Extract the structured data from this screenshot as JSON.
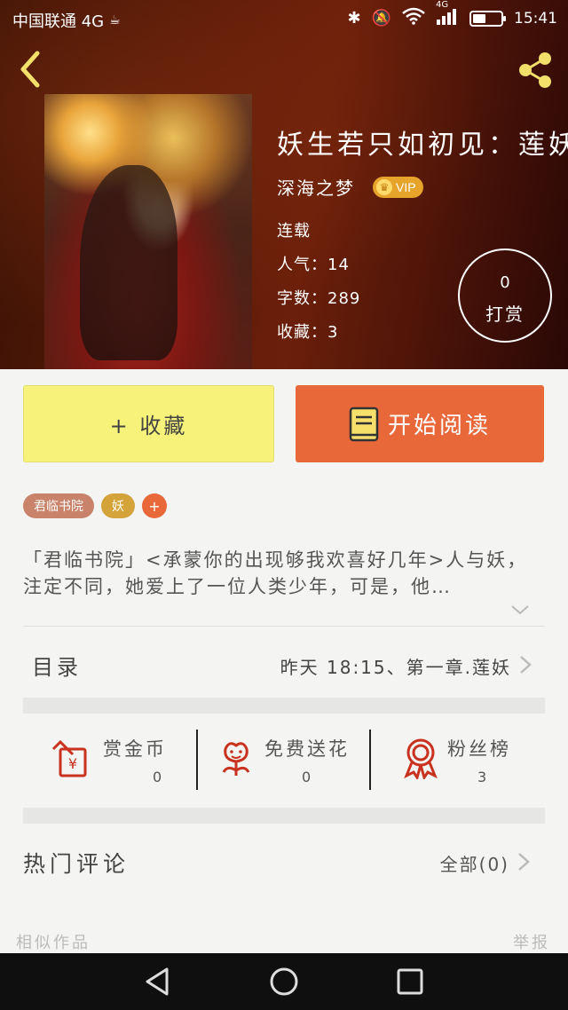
{
  "status_bar": {
    "carrier": "中国联通 4G",
    "network": "4G",
    "time": "15:41"
  },
  "book": {
    "title": "妖生若只如初见：莲妖",
    "author": "深海之梦",
    "vip_label": "VIP",
    "status": "连载",
    "popularity": "人气：14",
    "word_count": "字数：289",
    "favorites": "收藏：3"
  },
  "reward": {
    "count": "0",
    "label": "打赏"
  },
  "actions": {
    "collect_label": "+ 收藏",
    "read_label": "开始阅读"
  },
  "tags": {
    "tag1": "君临书院",
    "tag2": "妖",
    "add": "+"
  },
  "synopsis": "「君临书院」<承蒙你的出现够我欢喜好几年>人与妖，注定不同，她爱上了一位人类少年，可是，他…",
  "toc": {
    "label": "目录",
    "latest": "昨天 18:15、第一章.莲妖"
  },
  "stats": [
    {
      "label": "赏金币",
      "value": "0",
      "icon": "gold-coin-icon"
    },
    {
      "label": "免费送花",
      "value": "0",
      "icon": "flower-icon"
    },
    {
      "label": "粉丝榜",
      "value": "3",
      "icon": "ribbon-medal-icon"
    }
  ],
  "comments": {
    "label": "热门评论",
    "all": "全部(0)"
  },
  "footer": {
    "similar": "相似作品",
    "report": "举报"
  },
  "colors": {
    "collect_bg": "#f7f27a",
    "read_bg": "#e9683a",
    "icon_red": "#c8321e"
  }
}
